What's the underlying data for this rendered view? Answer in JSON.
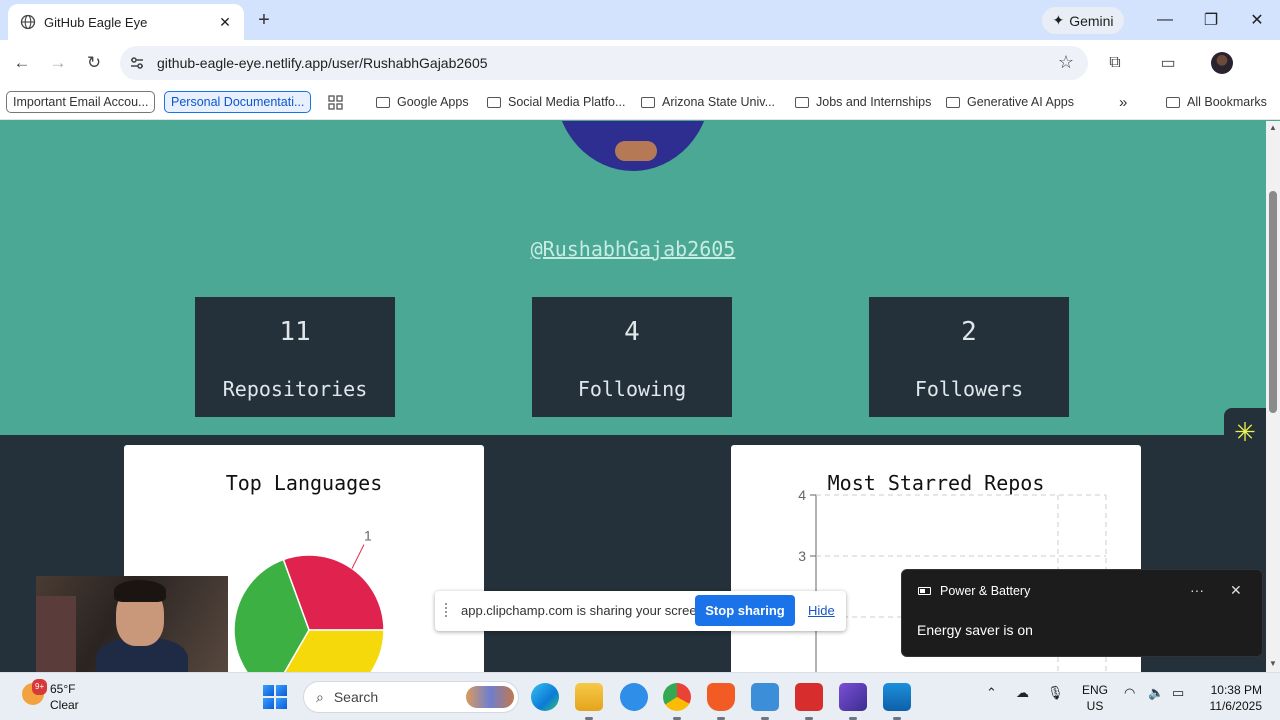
{
  "browser": {
    "tab_title": "GitHub Eagle Eye",
    "gemini_label": "Gemini",
    "url": "github-eagle-eye.netlify.app/user/RushabhGajab2605"
  },
  "bookmarks": {
    "items": [
      "Important Email Accou...",
      "Personal Documentati...",
      "Google Apps",
      "Social Media Platfo...",
      "Arizona State Univ...",
      "Jobs and Internships",
      "Generative AI Apps"
    ],
    "all_bookmarks": "All Bookmarks"
  },
  "profile": {
    "handle": "@RushabhGajab2605",
    "stats": [
      {
        "value": "11",
        "label": "Repositories"
      },
      {
        "value": "4",
        "label": "Following"
      },
      {
        "value": "2",
        "label": "Followers"
      }
    ]
  },
  "cards": {
    "languages_title": "Top Languages",
    "starred_title": "Most Starred Repos"
  },
  "chart_data": [
    {
      "type": "pie",
      "title": "Top Languages",
      "slices": [
        {
          "color": "#e0234e",
          "label": "1"
        },
        {
          "color": "#f5d90a"
        },
        {
          "color": "#3cb043"
        }
      ]
    },
    {
      "type": "bar",
      "title": "Most Starred Repos",
      "yticks": [
        "4",
        "3"
      ],
      "ylim": [
        0,
        4
      ],
      "grid": true
    }
  ],
  "sharebar": {
    "message": "app.clipchamp.com is sharing your screen.",
    "stop_label": "Stop sharing",
    "hide_label": "Hide"
  },
  "toast": {
    "title": "Power & Battery",
    "body": "Energy saver is on"
  },
  "taskbar": {
    "weather_temp": "65°F",
    "weather_desc": "Clear",
    "weather_badge": "9+",
    "search_placeholder": "Search",
    "lang_1": "ENG",
    "lang_2": "US",
    "time": "10:38 PM",
    "date": "11/6/2025"
  }
}
